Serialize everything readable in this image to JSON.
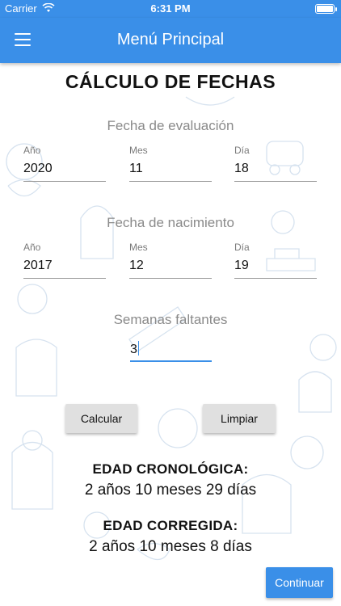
{
  "status_bar": {
    "carrier": "Carrier",
    "time": "6:31 PM"
  },
  "app_bar": {
    "title": "Menú Principal"
  },
  "page": {
    "title": "CÁLCULO DE FECHAS"
  },
  "evaluation": {
    "label": "Fecha de evaluación",
    "year_label": "Año",
    "year_value": "2020",
    "month_label": "Mes",
    "month_value": "11",
    "day_label": "Día",
    "day_value": "18"
  },
  "birth": {
    "label": "Fecha de nacimiento",
    "year_label": "Año",
    "year_value": "2017",
    "month_label": "Mes",
    "month_value": "12",
    "day_label": "Día",
    "day_value": "19"
  },
  "weeks": {
    "label": "Semanas faltantes",
    "value": "3"
  },
  "actions": {
    "calculate_label": "Calcular",
    "clear_label": "Limpiar",
    "continue_label": "Continuar"
  },
  "results": {
    "chronological_title": "EDAD CRONOLÓGICA:",
    "chronological_value": "2 años 10 meses 29 días",
    "corrected_title": "EDAD CORREGIDA:",
    "corrected_value": "2 años 10 meses 8 días"
  },
  "colors": {
    "primary": "#3a8fe8",
    "button_gray": "#e0e0e0",
    "label_gray": "#8a8a8a"
  },
  "icons": [
    "wifi-icon",
    "battery-icon",
    "hamburger-menu-icon"
  ]
}
